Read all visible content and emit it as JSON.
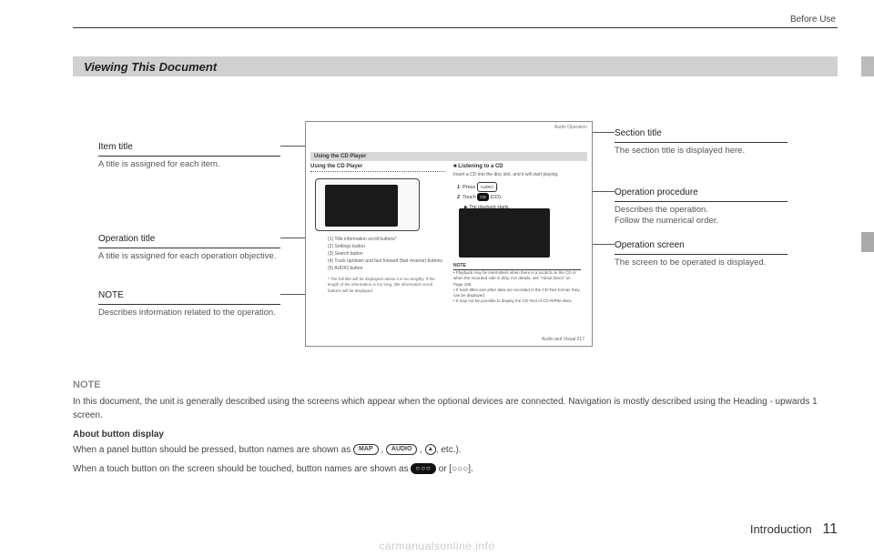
{
  "header_text": "Before Use",
  "title_bar": "Viewing This Document",
  "left_callouts": {
    "item_title": {
      "heading": "Item title",
      "body": "A title is assigned for each item."
    },
    "operation_title": {
      "heading": "Operation title",
      "body": "A title is assigned for each operation objective."
    },
    "note": {
      "heading": "NOTE",
      "body": "Describes information related to the operation."
    }
  },
  "right_callouts": {
    "section_title": {
      "heading": "Section title",
      "body": "The section title is displayed here."
    },
    "operation_procedure": {
      "heading": "Operation procedure",
      "body": "Describes the operation.\nFollow the numerical order."
    },
    "operation_screen": {
      "heading": "Operation screen",
      "body": "The screen to be operated is displayed."
    }
  },
  "sample": {
    "top_right": "Audio Operation",
    "section_bar": "Using the CD Player",
    "op_title": "Using the CD Player",
    "legend": {
      "1": "Title information scroll buttons*",
      "2": "Settings button",
      "3": "Search button",
      "4": "Track up/down and fast forward (fast reverse) buttons",
      "5": "AUDIO button"
    },
    "footnote": "* The full title will be displayed unless it is too lengthy. If the length of the information is too long, title information scroll buttons will be displayed.",
    "right_head": "■ Listening to a CD",
    "right_sub": "Insert a CD into the disc slot, and it will start playing.",
    "step1_pre": "Press",
    "step1_pill": "AUDIO",
    "step2_pre": "Touch",
    "step2_pill": "CD",
    "step2_post": "(CD).",
    "step2_result": "▶ The playback starts.",
    "note_heading": "NOTE",
    "note_bullets": [
      "Playback may be intermittent when there is a scratch on the CD or when the recorded side is dirty. For details, see \"About Discs\" on Page 186.",
      "If track titles and other data are recorded in the CD-Text format, they can be displayed.",
      "It may not be possible to display the CD-Text of CD-R/RW discs."
    ],
    "footer": "Audio and Visual   217"
  },
  "bottom_note": {
    "heading": "NOTE",
    "p1": "In this document, the unit is generally described using the screens which appear when the optional devices are connected. Navigation is mostly described using the Heading - upwards 1 screen.",
    "sub": "About button display",
    "p2_pre": "When a panel button should be pressed, button names are shown as ",
    "p2_btn1": "MAP",
    "p2_btn2": "AUDIO",
    "p2_post": ", etc.).",
    "p3_pre": "When a touch button on the screen should be touched, button names are shown as ",
    "p3_black": "○○○",
    "p3_mid": " or [",
    "p3_txt": "○○○",
    "p3_post": "]."
  },
  "page_footer": {
    "chapter": "Introduction",
    "num": "11"
  },
  "watermark": "carmanualsonline.info"
}
